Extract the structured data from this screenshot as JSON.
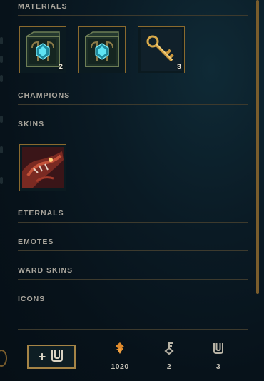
{
  "sections": {
    "materials": "MATERIALS",
    "champions": "CHAMPIONS",
    "skins": "SKINS",
    "eternals": "ETERNALS",
    "emotes": "EMOTES",
    "ward_skins": "WARD SKINS",
    "icons": "ICONS"
  },
  "materials": [
    {
      "name": "hextech-chest",
      "count": "2"
    },
    {
      "name": "hextech-chest",
      "count": ""
    },
    {
      "name": "hextech-key",
      "count": "3"
    }
  ],
  "skins": [
    {
      "name": "skin-shard",
      "count": ""
    }
  ],
  "footer": {
    "open_label": "+",
    "orange_essence": "1020",
    "keys": "2",
    "chests": "3"
  },
  "colors": {
    "gold": "#c8aa6e",
    "orange": "#e08a2c",
    "hextech": "#33d0e0"
  }
}
